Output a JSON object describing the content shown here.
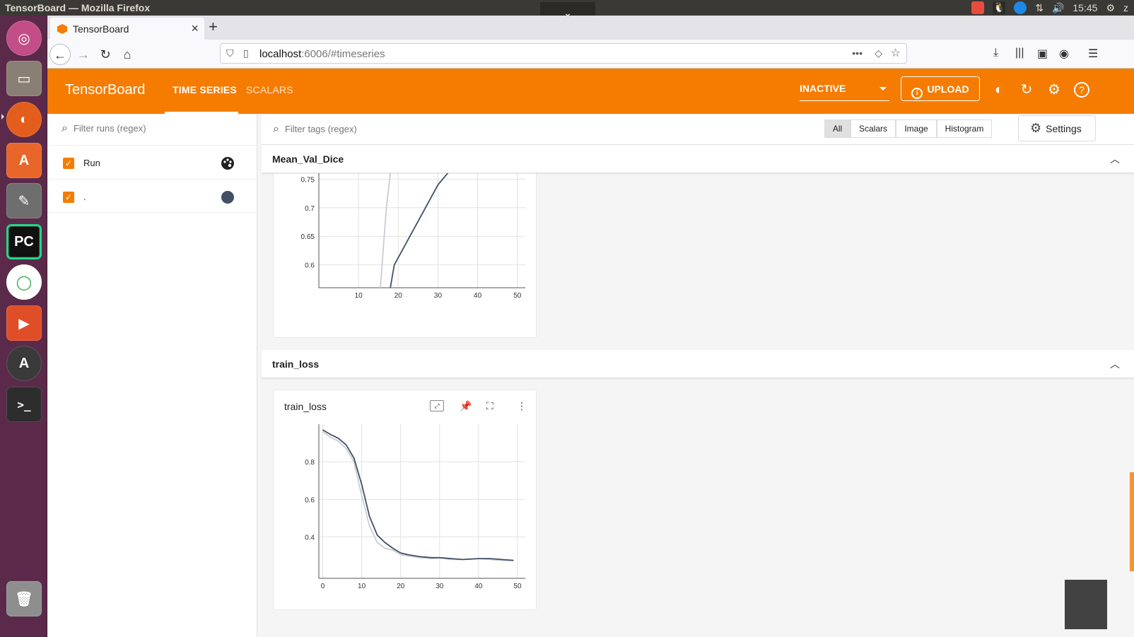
{
  "system": {
    "window_title": "TensorBoard — Mozilla Firefox",
    "clock": "15:45",
    "user_initial": "z"
  },
  "browser": {
    "tab_title": "TensorBoard",
    "url_host": "localhost",
    "url_path": ":6006/#timeseries"
  },
  "header": {
    "brand": "TensorBoard",
    "tabs": [
      {
        "label": "TIME SERIES",
        "active": true
      },
      {
        "label": "SCALARS",
        "active": false
      }
    ],
    "status_select": "INACTIVE",
    "upload_label": "UPLOAD"
  },
  "sidebar": {
    "filter_placeholder": "Filter runs (regex)",
    "runs": [
      {
        "label": "Run",
        "checked": true,
        "icon": "palette-icon"
      },
      {
        "label": ".",
        "checked": true,
        "color": "#425066"
      }
    ]
  },
  "main": {
    "filter_placeholder": "Filter tags (regex)",
    "segments": [
      "All",
      "Scalars",
      "Image",
      "Histogram"
    ],
    "selected_segment": "All",
    "settings_label": "Settings",
    "groups": [
      {
        "title": "Mean_Val_Dice"
      },
      {
        "title": "train_loss"
      }
    ],
    "train_loss_card_title": "train_loss"
  },
  "chart_data": [
    {
      "type": "line",
      "title": "",
      "xlabel": "",
      "ylabel": "",
      "xlim": [
        0,
        52
      ],
      "ylim": [
        0.56,
        0.79
      ],
      "x_ticks": [
        10,
        20,
        30,
        40,
        50
      ],
      "y_ticks": [
        0.6,
        0.65,
        0.7,
        0.75
      ],
      "series": [
        {
          "color": "#c9cdd3",
          "x": [
            15.5,
            17,
            18.5
          ],
          "y": [
            0.56,
            0.7,
            0.79
          ]
        },
        {
          "color": "#425066",
          "x": [
            18,
            19,
            30,
            36
          ],
          "y": [
            0.56,
            0.6,
            0.74,
            0.79
          ]
        }
      ]
    },
    {
      "type": "line",
      "title": "train_loss",
      "xlabel": "",
      "ylabel": "",
      "xlim": [
        -1,
        52
      ],
      "ylim": [
        0.18,
        1.0
      ],
      "x_ticks": [
        0,
        10,
        20,
        30,
        40,
        50
      ],
      "y_ticks": [
        0.4,
        0.6,
        0.8
      ],
      "series": [
        {
          "color": "#c9cdd3",
          "x": [
            0,
            2,
            4,
            6,
            8,
            10,
            12,
            14,
            16,
            18,
            20,
            22,
            25,
            28,
            30,
            33,
            36,
            40,
            43,
            46,
            49
          ],
          "y": [
            0.96,
            0.93,
            0.91,
            0.87,
            0.8,
            0.62,
            0.46,
            0.37,
            0.34,
            0.33,
            0.305,
            0.3,
            0.29,
            0.285,
            0.29,
            0.28,
            0.28,
            0.285,
            0.28,
            0.275,
            0.275
          ]
        },
        {
          "color": "#425066",
          "x": [
            0,
            2,
            4,
            6,
            8,
            10,
            12,
            14,
            16,
            18,
            20,
            22,
            25,
            28,
            30,
            33,
            36,
            40,
            43,
            46,
            49
          ],
          "y": [
            0.97,
            0.945,
            0.925,
            0.89,
            0.82,
            0.68,
            0.51,
            0.41,
            0.37,
            0.34,
            0.315,
            0.305,
            0.295,
            0.29,
            0.29,
            0.285,
            0.28,
            0.285,
            0.285,
            0.28,
            0.275
          ]
        }
      ]
    }
  ]
}
